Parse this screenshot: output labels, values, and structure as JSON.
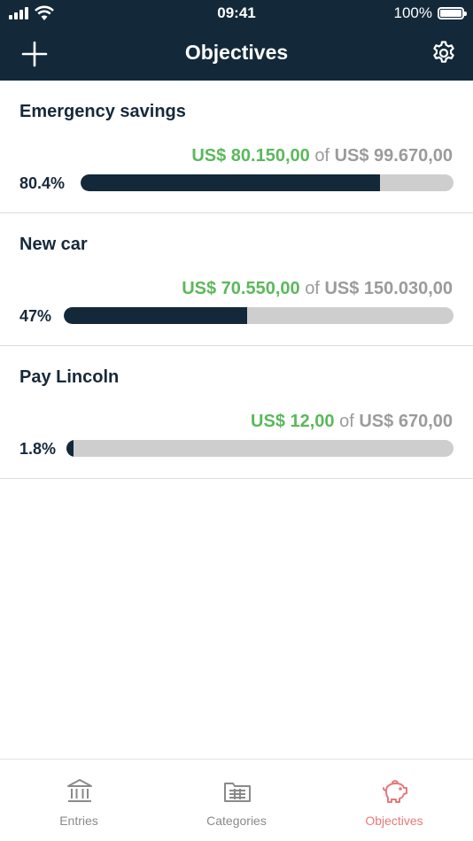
{
  "status_bar": {
    "time": "09:41",
    "battery": "100%"
  },
  "nav": {
    "title": "Objectives",
    "add_icon": "plus-icon",
    "settings_icon": "gear-icon"
  },
  "objectives": [
    {
      "name": "Emergency savings",
      "saved": "US$ 80.150,00",
      "of": "of",
      "target": "US$ 99.670,00",
      "percent_label": "80.4%",
      "progress": 0.804
    },
    {
      "name": "New car",
      "saved": "US$ 70.550,00",
      "of": "of",
      "target": "US$ 150.030,00",
      "percent_label": "47%",
      "progress": 0.47
    },
    {
      "name": "Pay Lincoln",
      "saved": "US$ 12,00",
      "of": "of",
      "target": "US$ 670,00",
      "percent_label": "1.8%",
      "progress": 0.018
    }
  ],
  "tabs": [
    {
      "label": "Entries",
      "icon": "bank-icon",
      "active": false
    },
    {
      "label": "Categories",
      "icon": "folder-icon",
      "active": false
    },
    {
      "label": "Objectives",
      "icon": "piggy-bank-icon",
      "active": true
    }
  ],
  "colors": {
    "header_bg": "#13293a",
    "saved_green": "#5cb85c",
    "progress_fill": "#13293a",
    "progress_track": "#cecece",
    "active_tab": "#e8787a",
    "inactive_tab": "#8a8a8a"
  }
}
